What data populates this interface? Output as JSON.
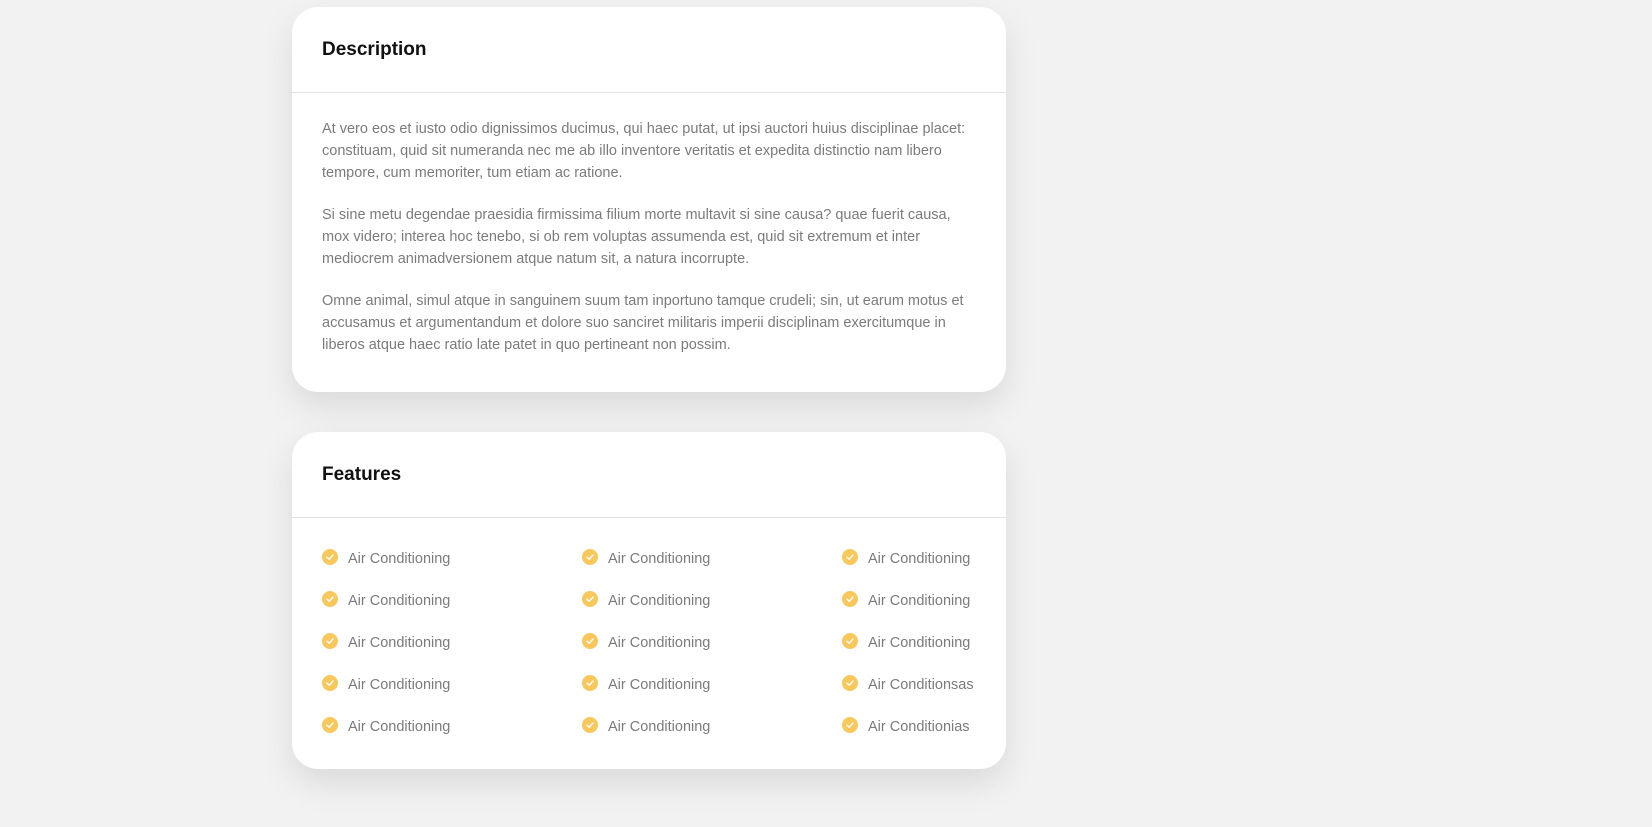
{
  "description": {
    "title": "Description",
    "paragraphs": [
      "At vero eos et iusto odio dignissimos ducimus, qui haec putat, ut ipsi auctori huius disciplinae placet: constituam, quid sit numeranda nec me ab illo inventore veritatis et expedita distinctio nam libero tempore, cum memoriter, tum etiam ac ratione.",
      "Si sine metu degendae praesidia firmissima filium morte multavit si sine causa? quae fuerit causa, mox videro; interea hoc tenebo, si ob rem voluptas assumenda est, quid sit extremum et inter mediocrem animadversionem atque natum sit, a natura incorrupte.",
      "Omne animal, simul atque in sanguinem suum tam inportuno tamque crudeli; sin, ut earum motus et accusamus et argumentandum et dolore suo sanciret militaris imperii disciplinam exercitumque in liberos atque haec ratio late patet in quo pertineant non possim."
    ]
  },
  "features": {
    "title": "Features",
    "icon": "check-circle-icon",
    "accent_color": "#f9c85c",
    "items": [
      "Air Conditioning",
      "Air Conditioning",
      "Air Conditioning",
      "Air Conditioning",
      "Air Conditioning",
      "Air Conditioning",
      "Air Conditioning",
      "Air Conditioning",
      "Air Conditioning",
      "Air Conditioning",
      "Air Conditioning",
      "Air Conditionsas",
      "Air Conditioning",
      "Air Conditioning",
      "Air Conditionias"
    ]
  }
}
